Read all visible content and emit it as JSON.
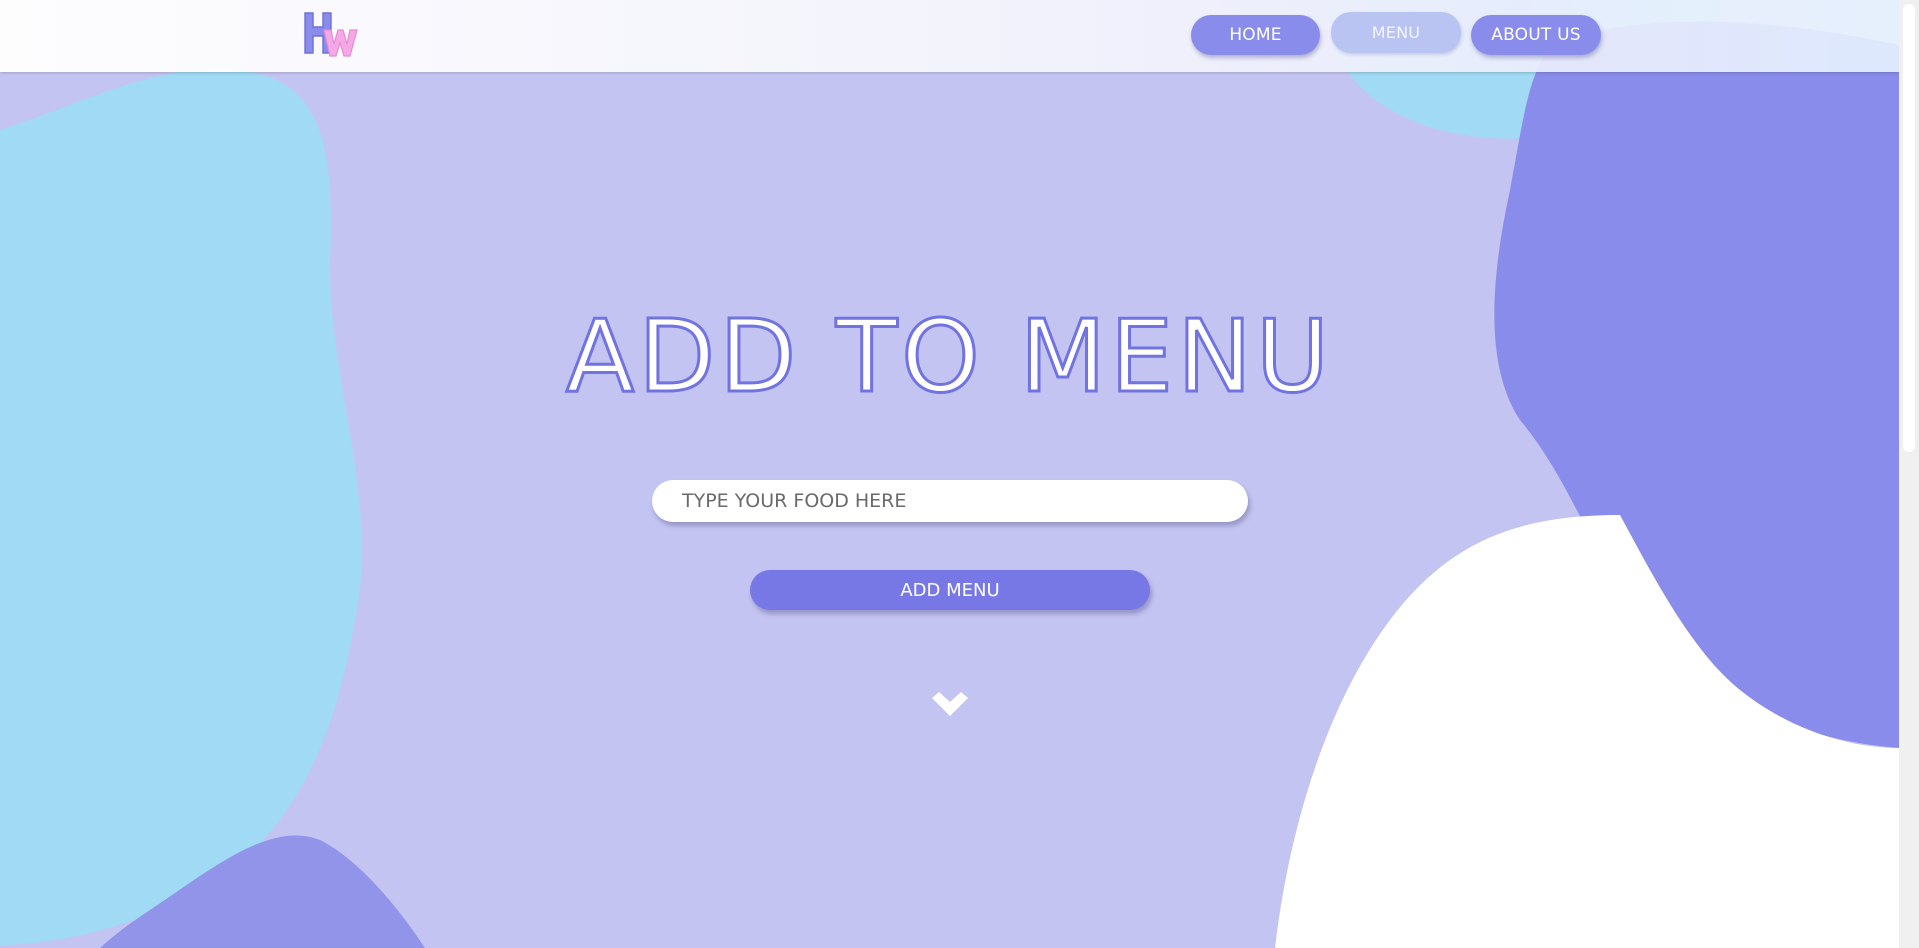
{
  "header": {
    "logo_letters": [
      "H",
      "W"
    ],
    "nav": {
      "home_label": "HOME",
      "menu_label": "MENU",
      "about_label": "ABOUT US"
    }
  },
  "hero": {
    "title": "ADD TO MENU",
    "input_placeholder": "TYPE YOUR FOOD HERE",
    "input_value": "",
    "button_label": "ADD MENU",
    "scroll_icon": "chevron-down-icon"
  },
  "colors": {
    "background": "#c4c4f2",
    "sky_blob": "#a0daf4",
    "violet_blob": "#8a8ceb",
    "button": "#7778e5",
    "title_stroke": "#7173e0",
    "nav_active": "#b9c4f2",
    "logo_h": "#8a8ceb",
    "logo_w": "#f6a8e6"
  }
}
